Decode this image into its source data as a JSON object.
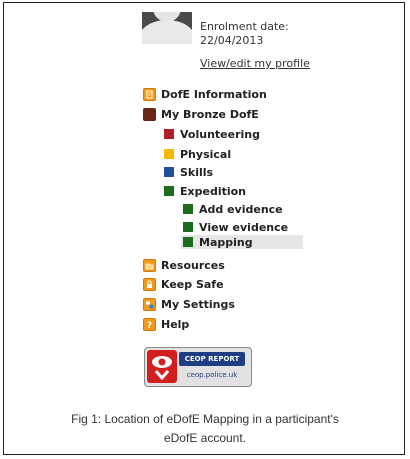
{
  "profile": {
    "enrolment_label": "Enrolment date:",
    "enrolment_date": "22/04/2013",
    "profile_link": "View/edit my profile"
  },
  "nav": {
    "dofe_information": "DofE Information",
    "my_bronze": "My Bronze DofE",
    "volunteering": "Volunteering",
    "physical": "Physical",
    "skills": "Skills",
    "expedition": "Expedition",
    "add_evidence": "Add evidence",
    "view_evidence": "View evidence",
    "mapping": "Mapping",
    "resources": "Resources",
    "keep_safe": "Keep Safe",
    "my_settings": "My Settings",
    "help": "Help"
  },
  "icons": {
    "dofe_information": "info-icon",
    "my_bronze": "bronze-square-icon",
    "resources": "folder-icon",
    "keep_safe": "lock-icon",
    "my_settings": "settings-icon",
    "help": "help-icon"
  },
  "colors": {
    "volunteering": "#b01e2a",
    "physical": "#f5b800",
    "skills": "#1f4fa0",
    "expedition": "#1d6b1d",
    "bronze": "#6b2418",
    "orange_icon": "#f39a1a"
  },
  "ceop": {
    "top": "CEOP REPORT",
    "bottom": "ceop.police.uk"
  },
  "caption": {
    "line1": "Fig 1: Location of eDofE Mapping in a participant's",
    "line2": "eDofE account."
  }
}
